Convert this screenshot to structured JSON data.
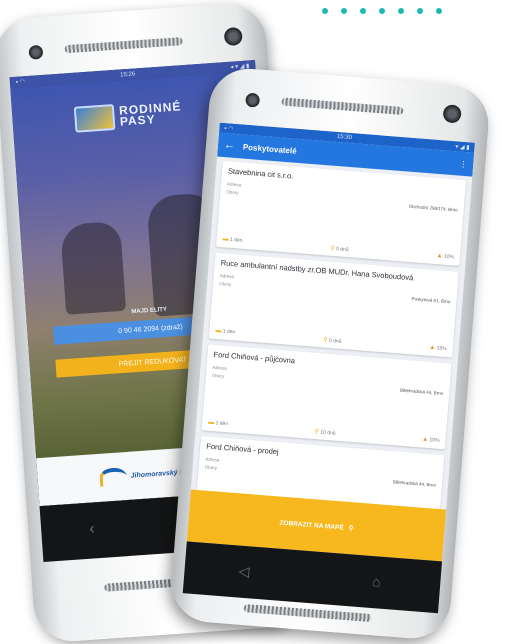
{
  "phone1": {
    "status_time": "15:26",
    "status_icons": "◂ ▾ ◢ ▮",
    "logo_text": "RODINNÉ PASY",
    "small_label": "MAJD ELITY",
    "blue_button": "0 90 46 2094 (zdraž)",
    "yellow_button": "PŘEJÍT REDUKOVAT",
    "footer_text": "Jihomoravský k"
  },
  "phone2": {
    "status_time": "15:30",
    "status_icons": "▾ ◢ ▮",
    "appbar_title": "Poskytovatelé",
    "cards": [
      {
        "title": "Stavebnina cit s.r.o.",
        "rows": [
          [
            "Adresa",
            ""
          ],
          [
            "Obory",
            "Obchodní 298/174, Brno"
          ]
        ],
        "foot": [
          "1 den",
          "0 dnů",
          "10%"
        ]
      },
      {
        "title": "Ruce ambulantní nadstby zr.OB MUDr. Hana Svoboudová",
        "rows": [
          [
            "Adresa",
            ""
          ],
          [
            "Obory",
            "Poskytová 61, Brno"
          ]
        ],
        "foot": [
          "1 den",
          "0 dnů",
          "15%"
        ]
      },
      {
        "title": "Ford Chiňová - půjčovna",
        "rows": [
          [
            "Adresa",
            ""
          ],
          [
            "Obory",
            "Bělehradská 44, Brno"
          ]
        ],
        "foot": [
          "1 den",
          "10 dnů",
          "10%"
        ]
      },
      {
        "title": "Ford Chiňová - prodej",
        "rows": [
          [
            "Adresa",
            ""
          ],
          [
            "Obory",
            "Bělehradská 44, Brno"
          ]
        ],
        "foot": [
          "",
          "",
          ""
        ]
      }
    ],
    "cta_label": "ZOBRAZIT NA MAPĚ",
    "cta_icon": "map-pin-icon"
  },
  "colors": {
    "accent_blue": "#2577e0",
    "accent_yellow": "#f6b81d",
    "dots_teal": "#1fb9b3"
  }
}
